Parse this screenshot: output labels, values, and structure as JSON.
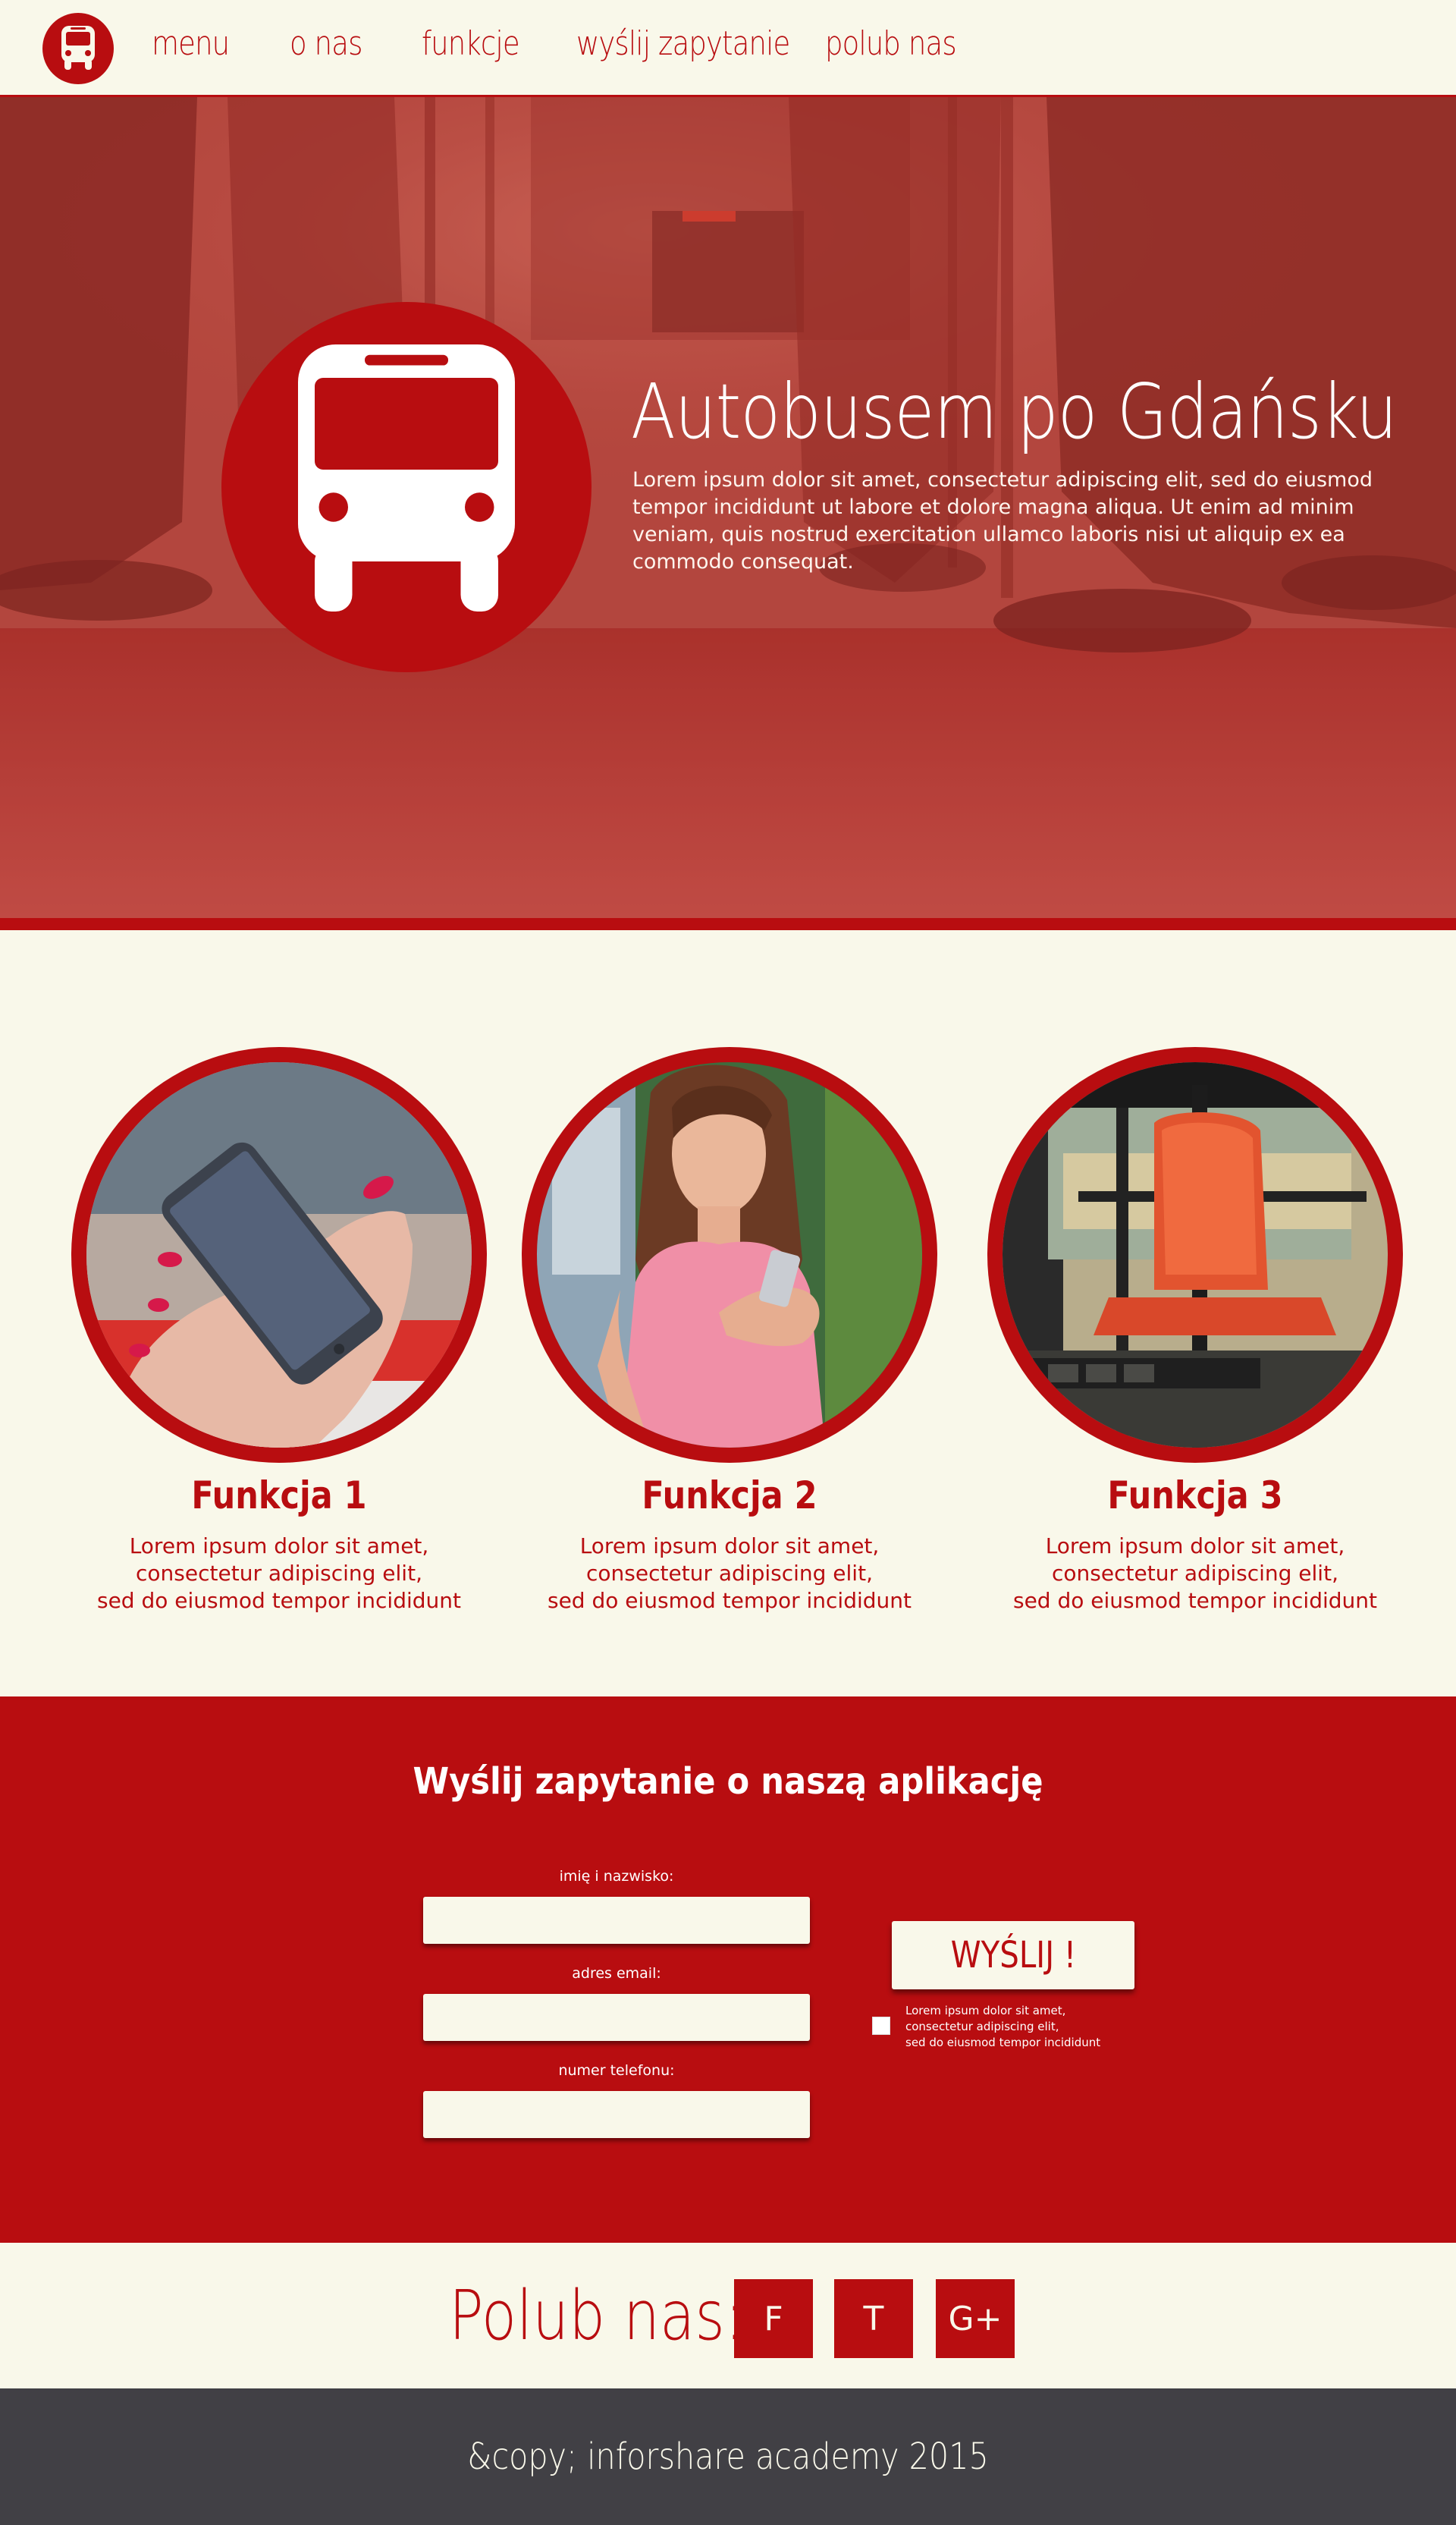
{
  "nav": {
    "items": [
      "menu",
      "o nas",
      "funkcje",
      "wyślij zapytanie",
      "polub nas"
    ],
    "logo_icon": "bus-icon"
  },
  "hero": {
    "title": "Autobusem po Gdańsku",
    "text": "Lorem ipsum dolor sit amet, consectetur adipiscing elit, sed do eiusmod tempor incididunt ut labore et dolore magna aliqua. Ut enim ad minim veniam, quis nostrud exercitation ullamco laboris nisi ut aliquip ex ea commodo consequat.",
    "icon": "bus-icon"
  },
  "features": [
    {
      "title": "Funkcja 1",
      "text": "Lorem ipsum dolor sit amet,\nconsectetur adipiscing elit,\nsed do eiusmod tempor incididunt",
      "image": "phone-in-hand"
    },
    {
      "title": "Funkcja 2",
      "text": "Lorem ipsum dolor sit amet,\nconsectetur adipiscing elit,\nsed do eiusmod tempor incididunt",
      "image": "woman-with-phone"
    },
    {
      "title": "Funkcja 3",
      "text": "Lorem ipsum dolor sit amet,\nconsectetur adipiscing elit,\nsed do eiusmod tempor incididunt",
      "image": "bus-seat"
    }
  ],
  "form": {
    "heading": "Wyślij zapytanie o naszą aplikację",
    "name_label": "imię i nazwisko:",
    "email_label": "adres email:",
    "phone_label": "numer telefonu:",
    "submit_label": "WYŚLIJ !",
    "checkbox_text": "Lorem ipsum dolor sit amet,\nconsectetur adipiscing elit,\nsed do eiusmod tempor incididunt"
  },
  "social": {
    "title": "Polub nas:",
    "buttons": [
      "F",
      "T",
      "G+"
    ]
  },
  "footer": {
    "text": "&copy; inforshare academy 2015"
  },
  "colors": {
    "primary": "#b80d10",
    "background": "#f9f8ea",
    "footer": "#414045"
  }
}
